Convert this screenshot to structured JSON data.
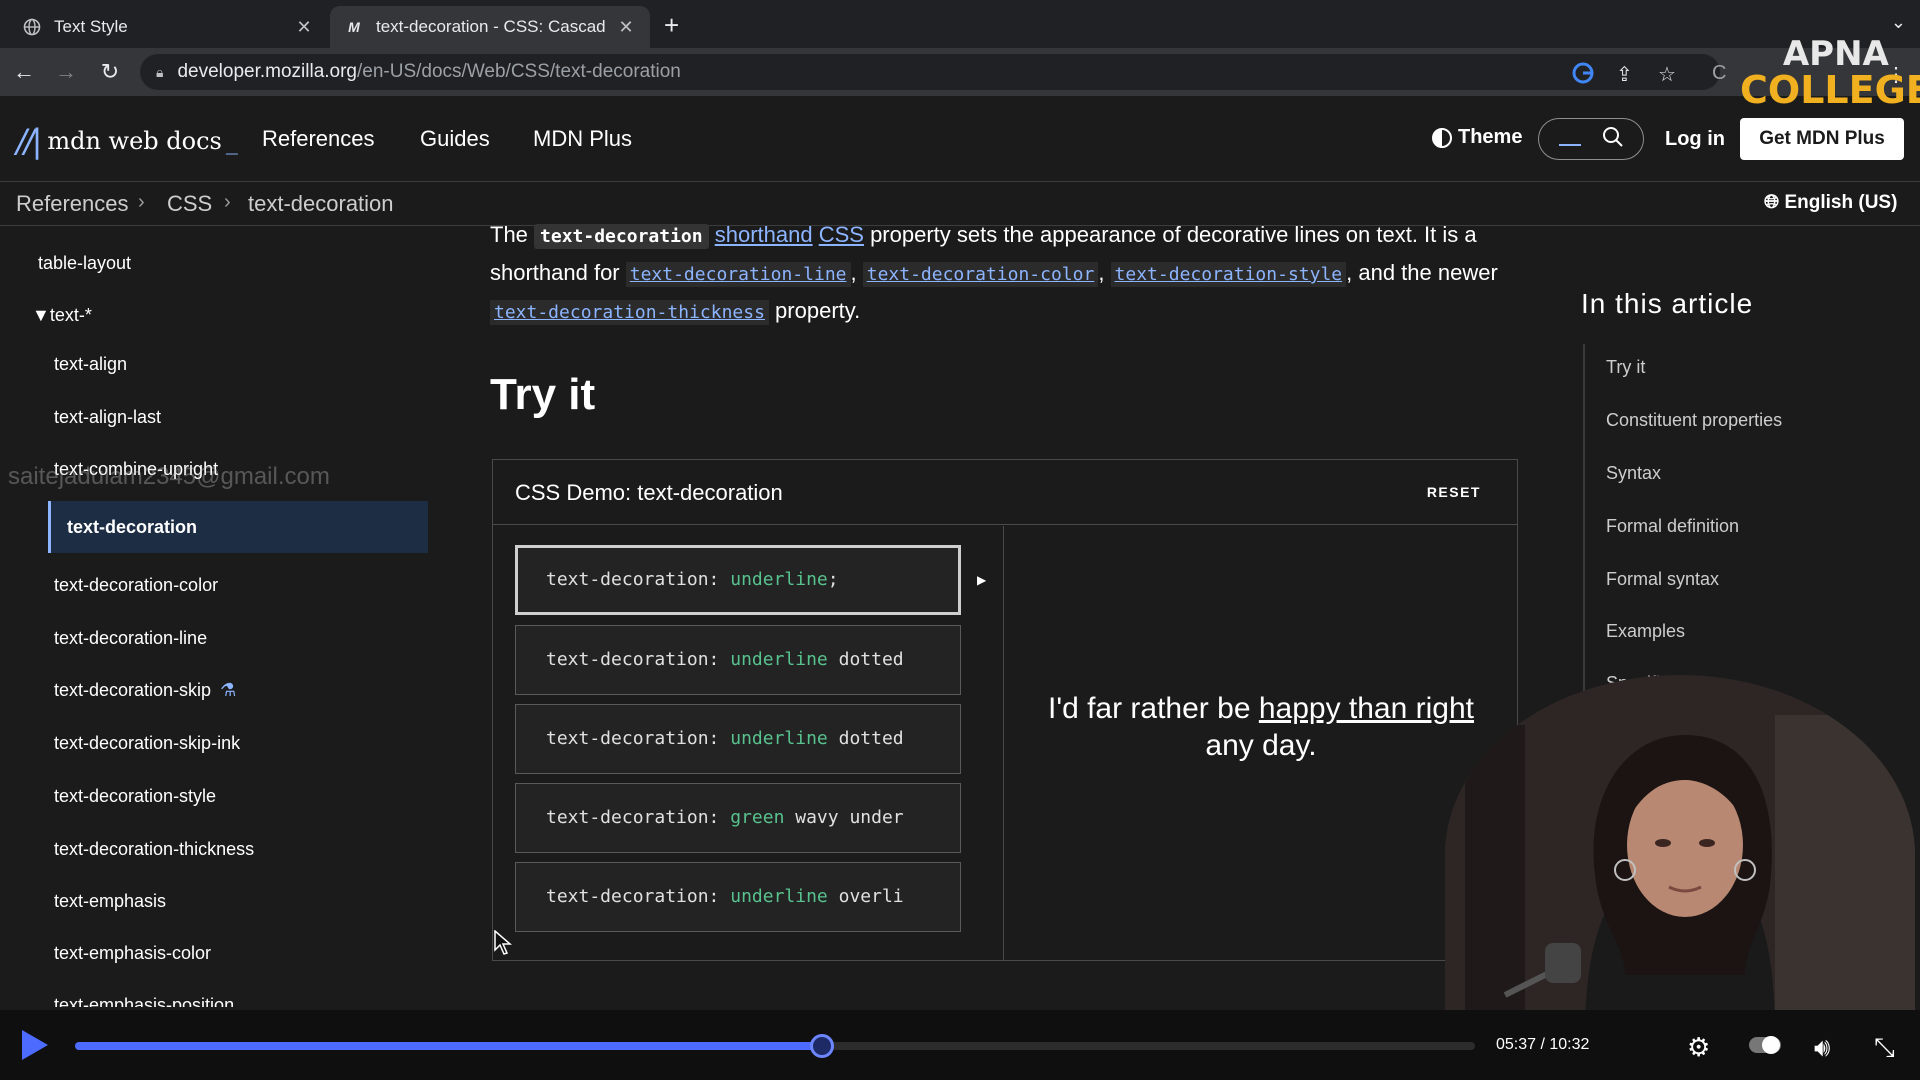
{
  "browser": {
    "tabs": [
      {
        "title": "Text Style",
        "icon": "globe-icon"
      },
      {
        "title": "text-decoration - CSS: Cascad",
        "icon": "mdn-icon"
      }
    ],
    "url_host": "developer.mozilla.org",
    "url_path": "/en-US/docs/Web/CSS/text-decoration"
  },
  "header": {
    "logo": "mdn web docs",
    "nav": [
      "References",
      "Guides",
      "MDN Plus"
    ],
    "theme": "Theme",
    "login": "Log in",
    "get_plus": "Get MDN Plus"
  },
  "breadcrumb": [
    "References",
    "CSS",
    "text-decoration"
  ],
  "language": "English (US)",
  "sidebar": {
    "items": [
      "table-layout",
      "▼text-*",
      "text-align",
      "text-align-last",
      "text-combine-upright",
      "text-decoration",
      "text-decoration-color",
      "text-decoration-line",
      "text-decoration-skip",
      "text-decoration-skip-ink",
      "text-decoration-style",
      "text-decoration-thickness",
      "text-emphasis",
      "text-emphasis-color",
      "text-emphasis-position"
    ],
    "active": "text-decoration",
    "watermark": "saitejadulam2345@gmail.com"
  },
  "intro": {
    "l1_a": "The ",
    "l1_code": "text-decoration",
    "l1_b": " ",
    "l1_link1": "shorthand",
    "l1_link2": "CSS",
    "l1_c": " property sets the appearance of decorative lines on text. It is a",
    "l2_a": "shorthand for ",
    "l2_link1": "text-decoration-line",
    "l2_link2": "text-decoration-color",
    "l2_link3": "text-decoration-style",
    "l2_b": ", and the newer",
    "l3_link": "text-decoration-thickness",
    "l3_b": " property."
  },
  "tryit_heading": "Try it",
  "demo": {
    "title": "CSS Demo: text-decoration",
    "reset": "RESET",
    "options": [
      {
        "prop": "text-decoration: ",
        "value": "underline",
        "rest": ";"
      },
      {
        "prop": "text-decoration: ",
        "value": "underline",
        "rest": " dotted"
      },
      {
        "prop": "text-decoration: ",
        "value": "underline",
        "rest": " dotted"
      },
      {
        "prop": "text-decoration: ",
        "value": "green",
        "rest": " wavy under"
      },
      {
        "prop": "text-decoration: ",
        "value": "underline",
        "rest": " overli"
      }
    ],
    "preview_a": "I'd far rather be ",
    "preview_u": "happy than right",
    "preview_b": "any day."
  },
  "toc": {
    "title": "In this article",
    "items": [
      "Try it",
      "Constituent properties",
      "Syntax",
      "Formal definition",
      "Formal syntax",
      "Examples",
      "Specifi"
    ]
  },
  "overlay_logo": {
    "line1": "APNA",
    "line2": "COLLEGE"
  },
  "video": {
    "time": "05:37 / 10:32",
    "progress": 0.5335
  },
  "colors": {
    "accent_link": "#8cb4ff",
    "code_value": "#58c28e",
    "player_accent": "#4d6cff"
  }
}
